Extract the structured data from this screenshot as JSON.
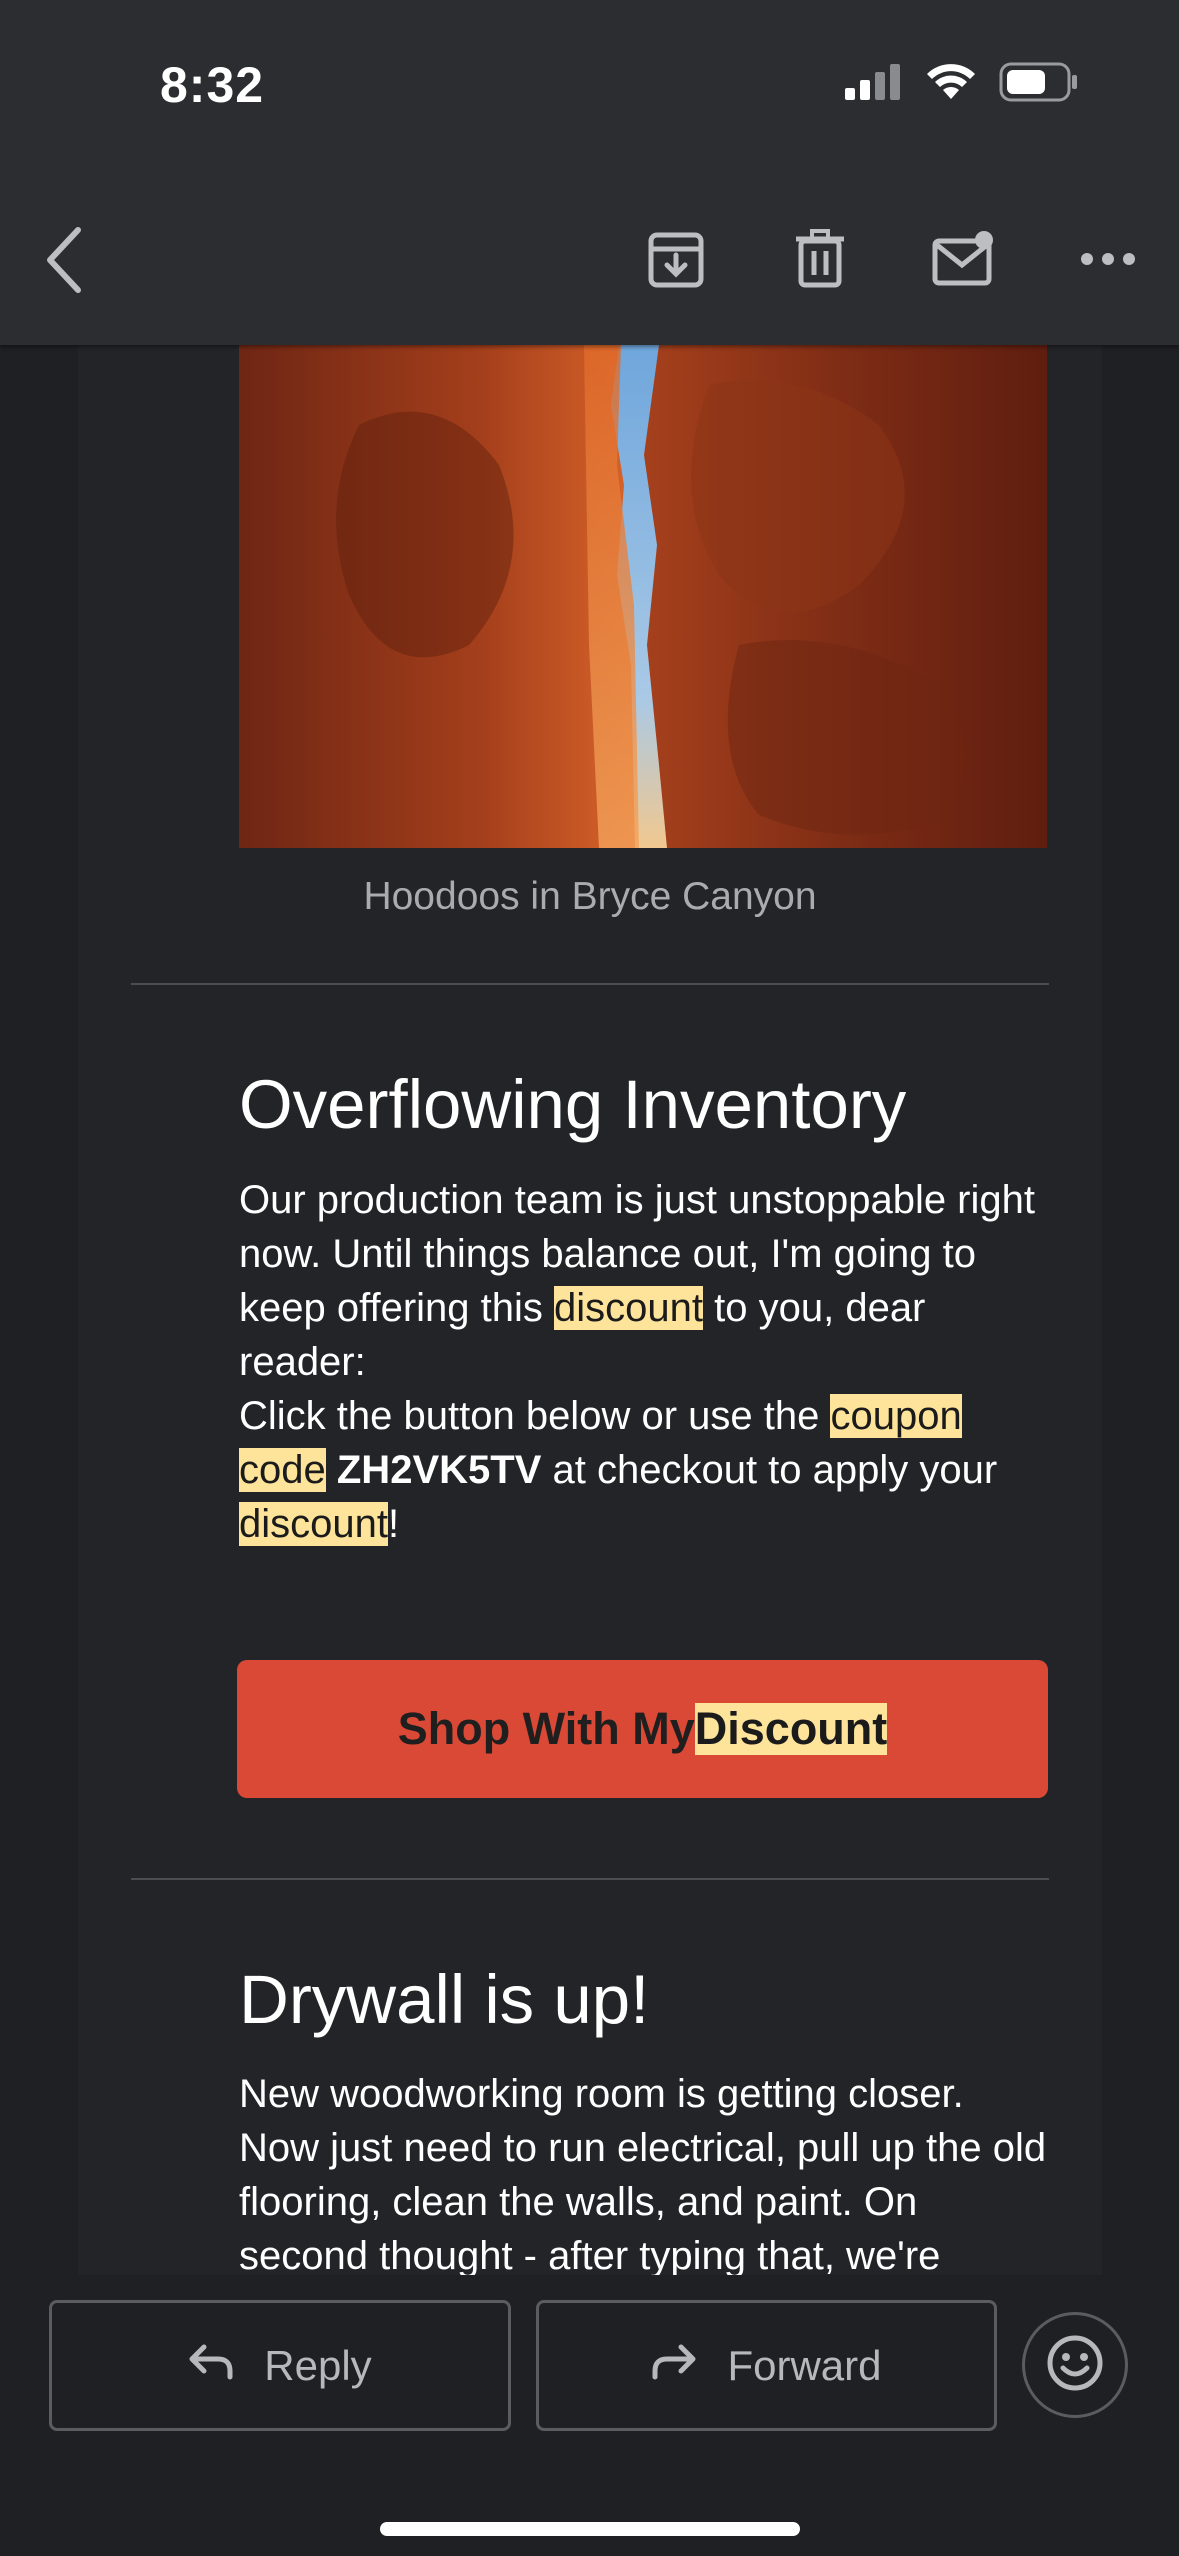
{
  "status_bar": {
    "time": "8:32"
  },
  "toolbar": {
    "back_icon": "chevron-left-icon",
    "icons": [
      "archive-icon",
      "trash-icon",
      "mark-unread-icon",
      "more-icon"
    ]
  },
  "email": {
    "image_caption": "Hoodoos in Bryce Canyon",
    "section1": {
      "title": "Overflowing Inventory",
      "para1_a": "Our production team is just unstoppable right now. Until things balance out, I'm going to keep offering this ",
      "para1_hl": "discount",
      "para1_b": " to you, dear reader:",
      "para2_a": "Click the button below or use the ",
      "para2_hl1": "coupon code",
      "para2_code": "ZH2VK5TV",
      "para2_b": " at checkout to apply your ",
      "para2_hl2": "discount",
      "para2_c": "!",
      "cta_a": "Shop With My ",
      "cta_hl": "Discount"
    },
    "section2": {
      "title": "Drywall is up!",
      "para": "New woodworking room is getting closer. Now just need to run electrical, pull up the old flooring, clean the walls, and paint. On second thought - after typing that, we're"
    }
  },
  "bottom_bar": {
    "reply_label": "Reply",
    "forward_label": "Forward"
  },
  "colors": {
    "accent": "#d94936",
    "highlight": "#fde49a",
    "background": "#1f2023"
  }
}
